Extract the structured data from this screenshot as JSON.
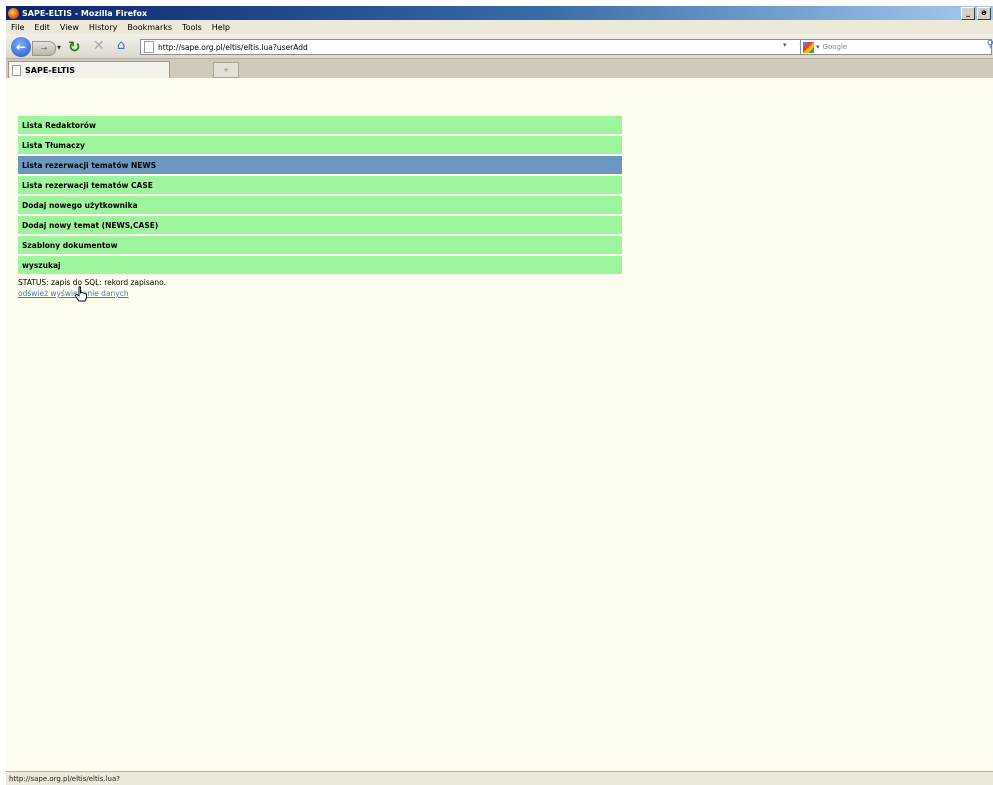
{
  "window": {
    "title": "SAPE-ELTIS - Mozilla Firefox",
    "min_label": "_",
    "max_label": "ə"
  },
  "menubar": {
    "items": [
      "File",
      "Edit",
      "View",
      "History",
      "Bookmarks",
      "Tools",
      "Help"
    ]
  },
  "navbar": {
    "url": "http://sape.org.pl/eltis/eltis.lua?userAdd",
    "search_placeholder": "Google",
    "icons": [
      "back-arrow-icon",
      "forward-arrow-icon",
      "reload-icon",
      "stop-icon",
      "home-icon",
      "bookmark-star-icon",
      "search-engine-icon",
      "magnifier-icon"
    ]
  },
  "tabs": {
    "active_label": "SAPE-ELTIS",
    "new_tab_label": "+"
  },
  "content": {
    "menu_items": [
      {
        "label": "Lista Redaktorów",
        "active": false
      },
      {
        "label": "Lista Tłumaczy",
        "active": false
      },
      {
        "label": "Lista rezerwacji tematów NEWS",
        "active": true
      },
      {
        "label": "Lista rezerwacji tematów CASE",
        "active": false
      },
      {
        "label": "Dodaj nowego użytkownika",
        "active": false
      },
      {
        "label": "Dodaj nowy temat (NEWS,CASE)",
        "active": false
      },
      {
        "label": "Szablony dokumentow",
        "active": false
      },
      {
        "label": "wyszukaj",
        "active": false
      }
    ],
    "status": "STATUS: zapis do SQL: rekord zapisano.",
    "refresh_link": "odśwież wyświetlanie danych"
  },
  "statusbar": {
    "text": "http://sape.org.pl/eltis/eltis.lua?"
  },
  "colors": {
    "menu_item": "#9ef59e",
    "menu_item_active": "#6b98bf",
    "page_bg": "#fffdf0",
    "link": "#3f7faf"
  }
}
